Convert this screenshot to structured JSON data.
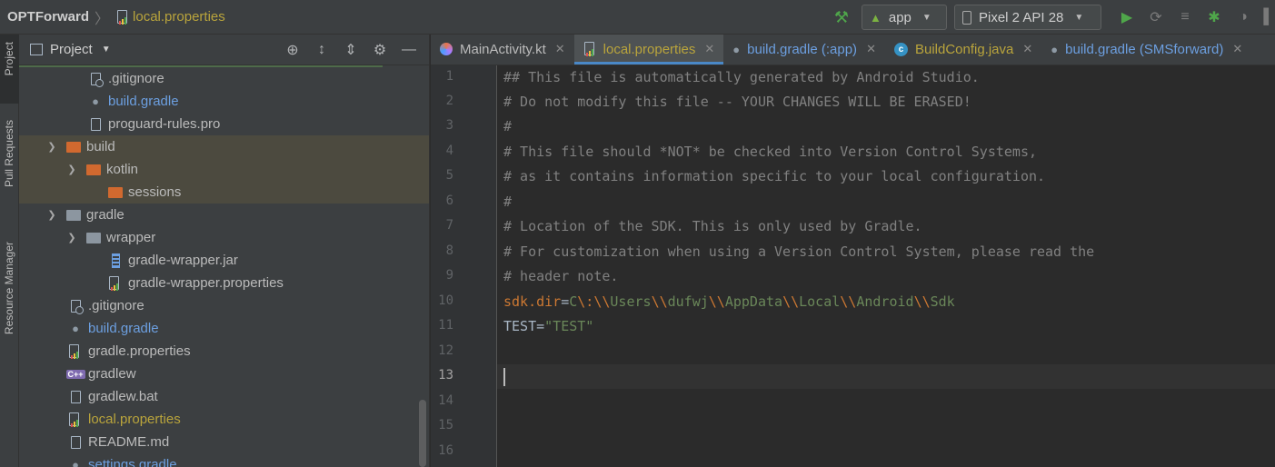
{
  "breadcrumb": {
    "project": "OPTForward",
    "file": "local.properties"
  },
  "toolbar": {
    "run_config": "app",
    "device": "Pixel 2 API 28"
  },
  "left_strip": {
    "tabs": [
      "Project",
      "Pull Requests",
      "Resource Manager"
    ]
  },
  "project_panel": {
    "title": "Project",
    "tree": [
      {
        "label": ".gitignore"
      },
      {
        "label": "build.gradle"
      },
      {
        "label": "proguard-rules.pro"
      },
      {
        "label": "build"
      },
      {
        "label": "kotlin"
      },
      {
        "label": "sessions"
      },
      {
        "label": "gradle"
      },
      {
        "label": "wrapper"
      },
      {
        "label": "gradle-wrapper.jar"
      },
      {
        "label": "gradle-wrapper.properties"
      },
      {
        "label": ".gitignore"
      },
      {
        "label": "build.gradle"
      },
      {
        "label": "gradle.properties"
      },
      {
        "label": "gradlew"
      },
      {
        "label": "gradlew.bat"
      },
      {
        "label": "local.properties"
      },
      {
        "label": "README.md"
      },
      {
        "label": "settings.gradle"
      }
    ]
  },
  "editor": {
    "tabs": [
      {
        "label": "MainActivity.kt"
      },
      {
        "label": "local.properties"
      },
      {
        "label": "build.gradle (:app)"
      },
      {
        "label": "BuildConfig.java"
      },
      {
        "label": "build.gradle (SMSforward)"
      }
    ],
    "line_numbers": [
      "1",
      "2",
      "3",
      "4",
      "5",
      "6",
      "7",
      "8",
      "9",
      "10",
      "11",
      "12",
      "13",
      "14",
      "15",
      "16"
    ],
    "lines": [
      "## This file is automatically generated by Android Studio.",
      "# Do not modify this file -- YOUR CHANGES WILL BE ERASED!",
      "#",
      "# This file should *NOT* be checked into Version Control Systems,",
      "# as it contains information specific to your local configuration.",
      "#",
      "# Location of the SDK. This is only used by Gradle.",
      "# For customization when using a Version Control System, please read the",
      "# header note."
    ],
    "sdk_line": {
      "key": "sdk.dir",
      "eq": "=",
      "parts": [
        "C",
        "\\:",
        "\\\\",
        "Users",
        "\\\\",
        "dufwj",
        "\\\\",
        "AppData",
        "\\\\",
        "Local",
        "\\\\",
        "Android",
        "\\\\",
        "Sdk"
      ]
    },
    "test_line": {
      "key": "TEST",
      "eq": "=",
      "value": "\"TEST\""
    }
  }
}
